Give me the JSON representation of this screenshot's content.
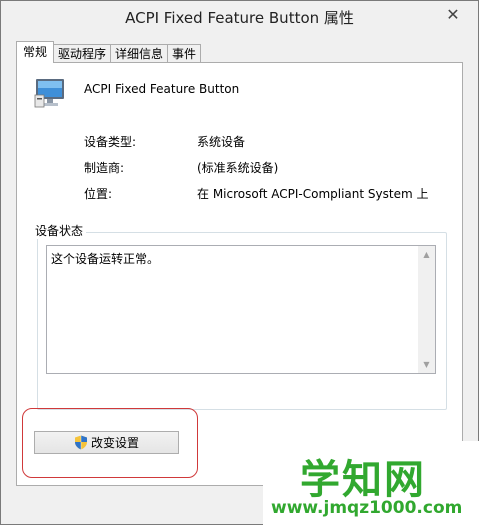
{
  "window": {
    "title": "ACPI Fixed Feature Button 属性",
    "close_glyph": "✕"
  },
  "tabs": [
    {
      "label": "常规",
      "active": true
    },
    {
      "label": "驱动程序",
      "active": false
    },
    {
      "label": "详细信息",
      "active": false
    },
    {
      "label": "事件",
      "active": false
    }
  ],
  "general": {
    "device_name": "ACPI Fixed Feature Button",
    "device_icon": "monitor-device-icon",
    "properties": [
      {
        "label": "设备类型:",
        "value": "系统设备"
      },
      {
        "label": "制造商:",
        "value": "(标准系统设备)"
      },
      {
        "label": "位置:",
        "value": "在 Microsoft ACPI-Compliant System 上"
      }
    ],
    "status_group_title": "设备状态",
    "status_text": "这个设备运转正常。",
    "change_settings_label": "改变设置",
    "change_settings_icon": "uac-shield-icon"
  },
  "watermark": {
    "logo_text": "学知网",
    "url_text": "www.jmqz1000.com"
  },
  "colors": {
    "highlight_border": "#d0393a",
    "watermark_green": "#31a82f",
    "dialog_bg": "#f0f0f0"
  }
}
